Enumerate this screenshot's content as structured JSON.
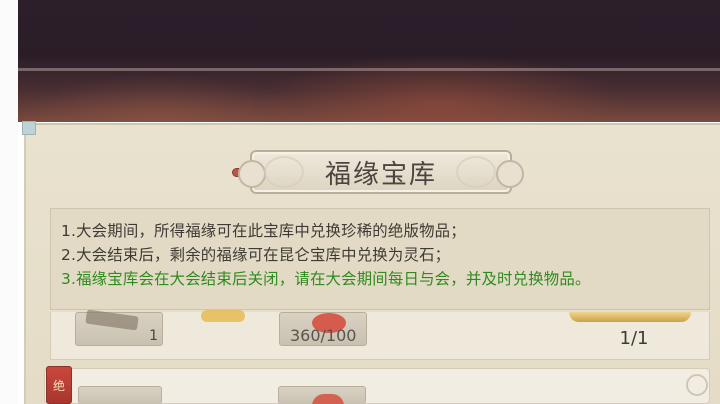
{
  "title": "福缘宝库",
  "info": {
    "line1": "1.大会期间，所得福缘可在此宝库中兑换珍稀的绝版物品；",
    "line2": "2.大会结束后，剩余的福缘可在昆仑宝库中兑换为灵石；",
    "line3": "3.福缘宝库会在大会结束后关闭，请在大会期间每日与会，并及时兑换物品。"
  },
  "items": {
    "row1": {
      "reward_count": "1",
      "cost_label": "360/100",
      "exchange_ratio": "1/1"
    },
    "row2": {
      "badge_char": "绝"
    }
  },
  "colors": {
    "highlight_text": "#2f8a1f",
    "body_text": "#3e3a35"
  }
}
